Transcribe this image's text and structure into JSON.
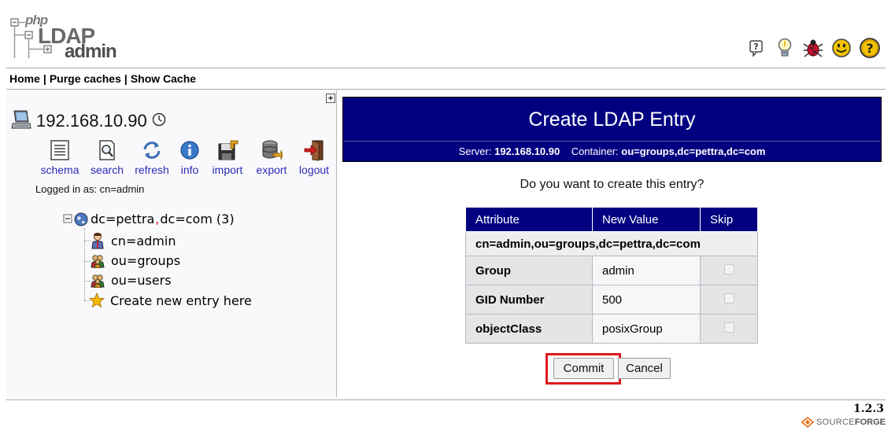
{
  "app": {
    "logo": {
      "line1": "php",
      "line2": "LDAP",
      "line3": "admin"
    },
    "version": "1.2.3",
    "sourceforge": {
      "part1": "SOURCE",
      "part2": "FORGE"
    }
  },
  "menu": {
    "home": "Home",
    "purge": "Purge caches",
    "show_cache": "Show Cache",
    "separator": "|"
  },
  "top_icons": [
    "help-icon",
    "lightbulb-icon",
    "bug-icon",
    "smiley-icon",
    "question-icon"
  ],
  "server": {
    "name": "192.168.10.90",
    "logged_in": "Logged in as: cn=admin",
    "actions": [
      {
        "label": "schema",
        "icon": "schema-icon"
      },
      {
        "label": "search",
        "icon": "search-icon"
      },
      {
        "label": "refresh",
        "icon": "refresh-icon"
      },
      {
        "label": "info",
        "icon": "info-icon"
      },
      {
        "label": "import",
        "icon": "import-icon"
      },
      {
        "label": "export",
        "icon": "export-icon"
      },
      {
        "label": "logout",
        "icon": "logout-icon"
      }
    ]
  },
  "tree": {
    "root": {
      "part1": "dc=pettra",
      "comma": ",",
      "part2": "dc=com",
      "count": "(3)"
    },
    "children": [
      {
        "label": "cn=admin",
        "icon": "user-icon"
      },
      {
        "label": "ou=groups",
        "icon": "ou-icon"
      },
      {
        "label": "ou=users",
        "icon": "ou-icon"
      },
      {
        "label": "Create new entry here",
        "icon": "star-icon"
      }
    ]
  },
  "main": {
    "title": "Create LDAP Entry",
    "server_label": "Server:",
    "server_value": "192.168.10.90",
    "container_label": "Container:",
    "container_value": "ou=groups,dc=pettra,dc=com",
    "question": "Do you want to create this entry?",
    "table": {
      "headers": [
        "Attribute",
        "New Value",
        "Skip"
      ],
      "dn": "cn=admin,ou=groups,dc=pettra,dc=com",
      "rows": [
        {
          "attribute": "Group",
          "value": "admin"
        },
        {
          "attribute": "GID Number",
          "value": "500"
        },
        {
          "attribute": "objectClass",
          "value": "posixGroup"
        }
      ]
    },
    "commit_label": "Commit",
    "cancel_label": "Cancel"
  },
  "colors": {
    "title_bg": "#000080",
    "link": "#2a2ab5",
    "highlight": "#e0181e"
  }
}
